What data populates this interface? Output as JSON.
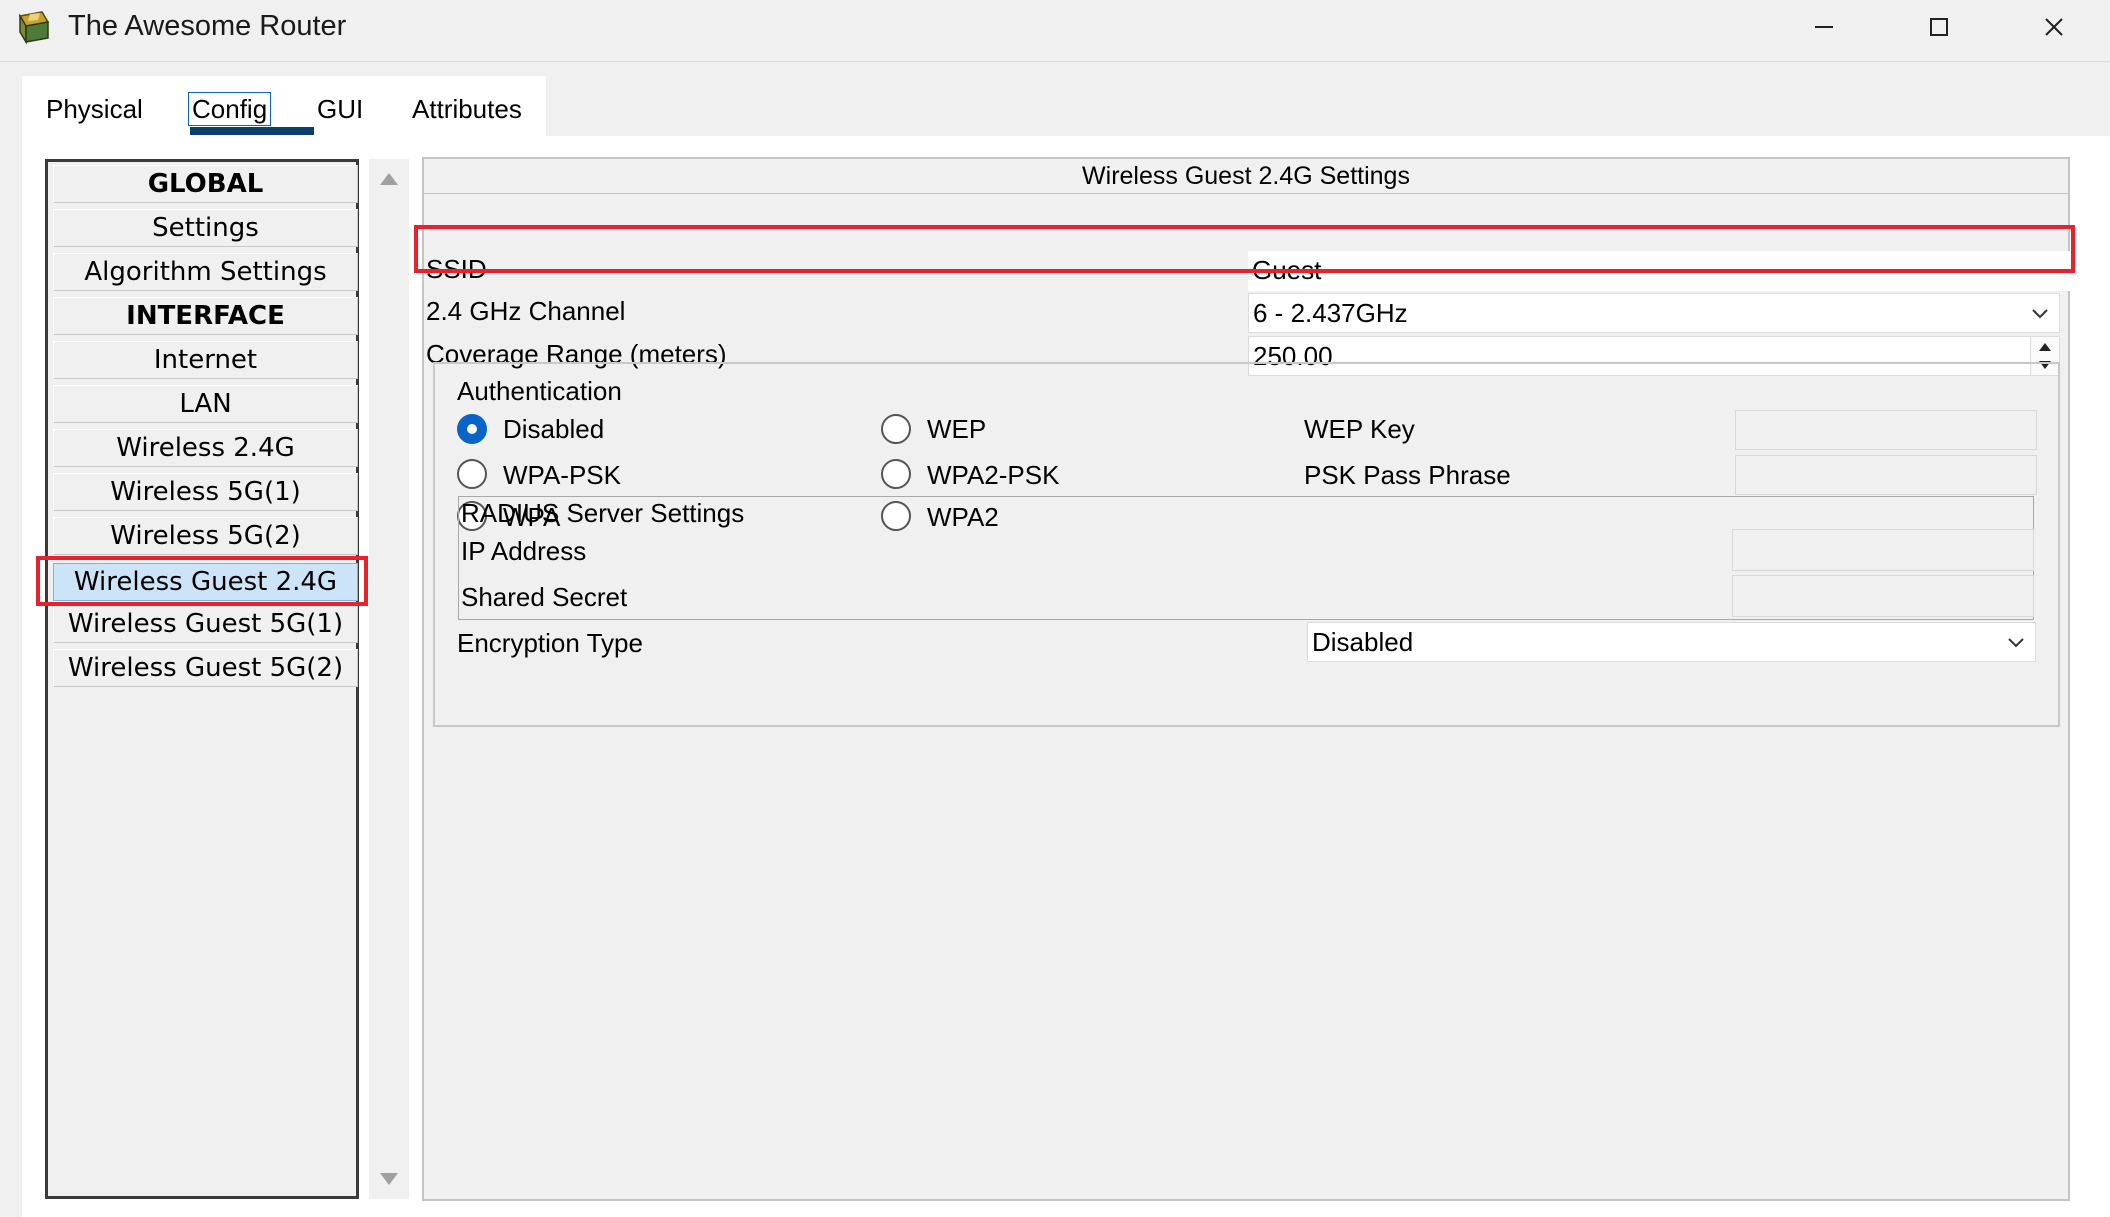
{
  "window": {
    "title": "The Awesome Router",
    "app_icon": "router-app-icon",
    "controls": [
      "minimize-icon",
      "maximize-icon",
      "close-icon"
    ]
  },
  "tabs": [
    {
      "label": "Physical",
      "active": false
    },
    {
      "label": "Config",
      "active": true
    },
    {
      "label": "GUI",
      "active": false
    },
    {
      "label": "Attributes",
      "active": false
    }
  ],
  "sidebar": {
    "items": [
      {
        "label": "GLOBAL",
        "type": "header"
      },
      {
        "label": "Settings"
      },
      {
        "label": "Algorithm Settings"
      },
      {
        "label": "INTERFACE",
        "type": "header"
      },
      {
        "label": "Internet"
      },
      {
        "label": "LAN"
      },
      {
        "label": "Wireless 2.4G"
      },
      {
        "label": "Wireless 5G(1)"
      },
      {
        "label": "Wireless 5G(2)"
      },
      {
        "label": "Wireless Guest 2.4G",
        "selected": true
      },
      {
        "label": "Wireless Guest 5G(1)"
      },
      {
        "label": "Wireless Guest 5G(2)"
      }
    ]
  },
  "panel": {
    "title": "Wireless Guest 2.4G Settings",
    "ssid": {
      "label": "SSID",
      "value": "Guest"
    },
    "channel": {
      "label": "2.4 GHz Channel",
      "value": "6 - 2.437GHz"
    },
    "coverage": {
      "label": "Coverage Range (meters)",
      "value": "250.00"
    },
    "auth": {
      "heading": "Authentication",
      "options": {
        "disabled": "Disabled",
        "wep": "WEP",
        "wpa_psk": "WPA-PSK",
        "wpa2_psk": "WPA2-PSK",
        "wpa": "WPA",
        "wpa2": "WPA2"
      },
      "selected": "Disabled",
      "wep_key_label": "WEP Key",
      "wep_key_value": "",
      "psk_label": "PSK Pass Phrase",
      "psk_value": ""
    },
    "radius": {
      "heading": "RADIUS Server Settings",
      "ip_label": "IP Address",
      "ip_value": "",
      "secret_label": "Shared Secret",
      "secret_value": ""
    },
    "encryption": {
      "label": "Encryption Type",
      "value": "Disabled"
    }
  },
  "colors": {
    "highlight": "#e8212b",
    "accent": "#0a64c8",
    "selected_bg": "#cce4f7",
    "tab_underline": "#0b3d6e"
  }
}
